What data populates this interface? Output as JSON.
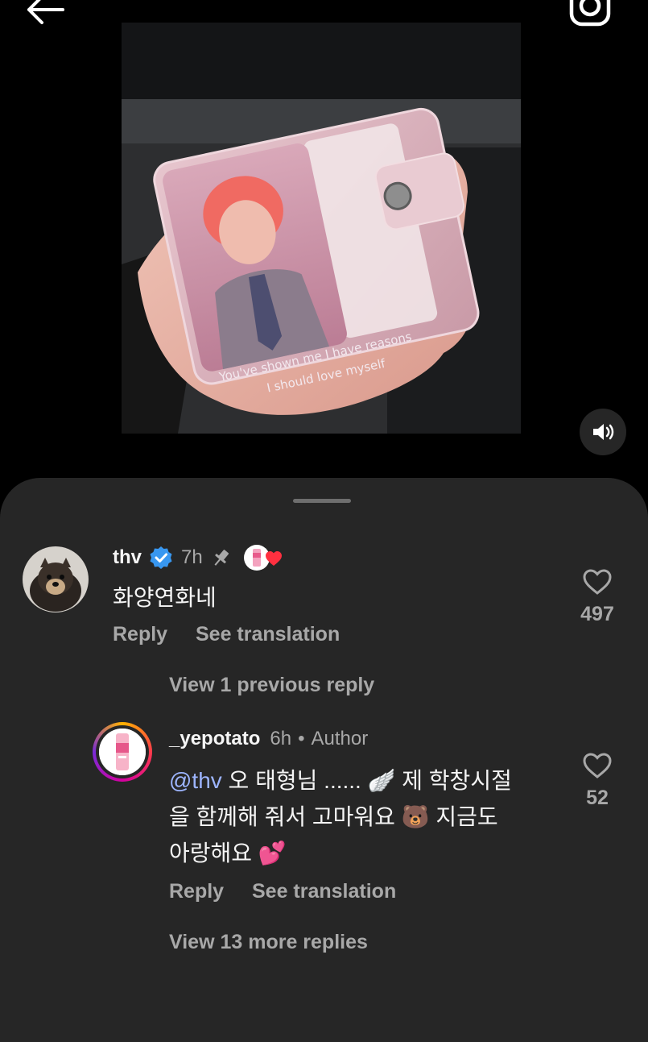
{
  "post": {
    "overlay_line_1": "You've shown me I have reasons",
    "overlay_line_2": "I should love myself"
  },
  "comments": [
    {
      "username": "thv",
      "time": "7h",
      "text": "화양연화네",
      "likes": "497",
      "reply_label": "Reply",
      "translate_label": "See translation",
      "verified": true,
      "pinned": true,
      "liked_by_author": true
    }
  ],
  "view_previous": "View 1 previous reply",
  "reply": {
    "username": "_yepotato",
    "time": "6h",
    "author_badge": "Author",
    "mention": "@thv",
    "line1_rest": " 오 태형님 ...... 🪽 제 학창시절",
    "line2": "을 함께해 줘서 고마워요 🐻 지금도",
    "line3": "아랑해요 💕",
    "likes": "52",
    "reply_label": "Reply",
    "translate_label": "See translation"
  },
  "view_more": "View 13 more replies",
  "colors": {
    "sheet": "#262626",
    "verified": "#3897f0",
    "mention": "#9db5ff",
    "secondary_text": "#a8a8a8"
  }
}
